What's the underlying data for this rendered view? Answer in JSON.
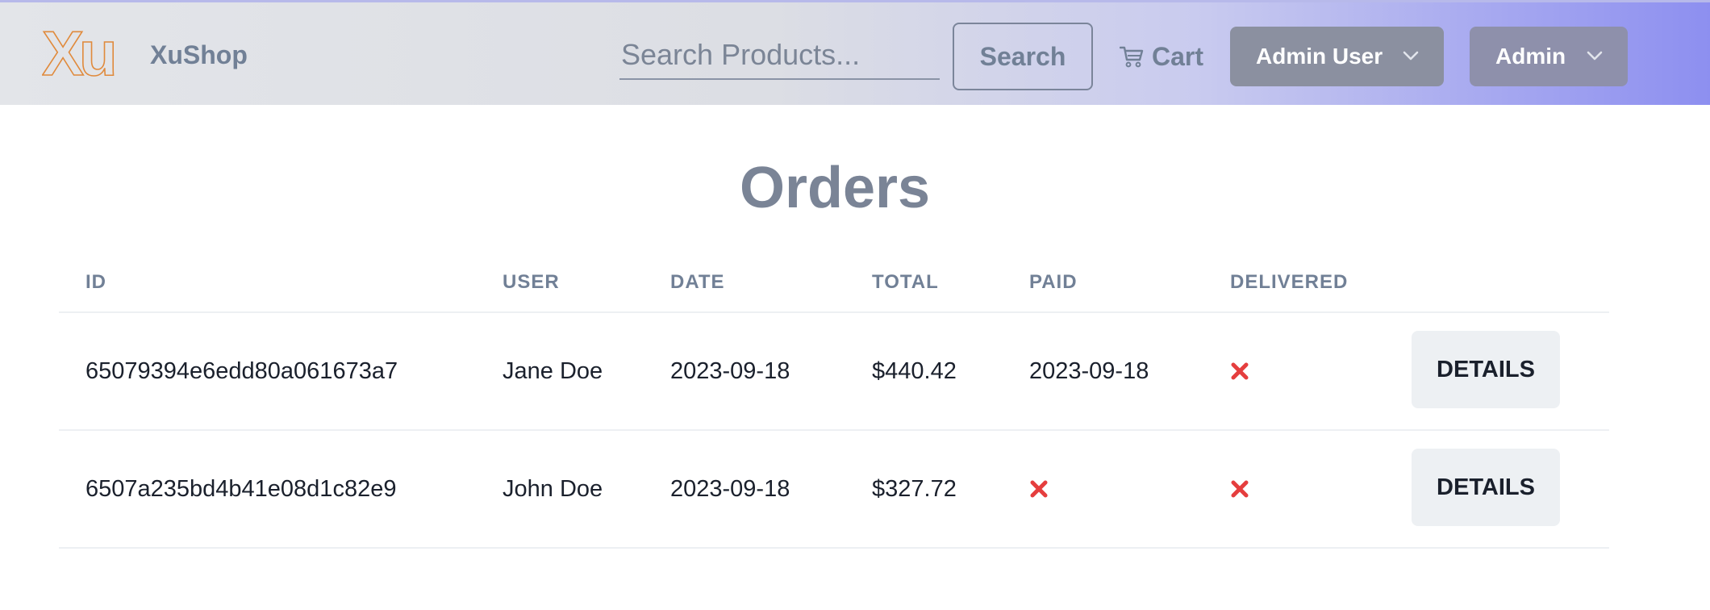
{
  "header": {
    "brand": "XuShop",
    "logo_text": "Xu",
    "search": {
      "placeholder": "Search Products...",
      "value": ""
    },
    "search_button": "Search",
    "cart_label": "Cart",
    "user_menu_label": "Admin User",
    "admin_menu_label": "Admin"
  },
  "page": {
    "title": "Orders"
  },
  "table": {
    "columns": [
      "ID",
      "USER",
      "DATE",
      "TOTAL",
      "PAID",
      "DELIVERED"
    ],
    "rows": [
      {
        "id": "65079394e6edd80a061673a7",
        "user": "Jane Doe",
        "date": "2023-09-18",
        "total": "$440.42",
        "paid": "2023-09-18",
        "paid_status": true,
        "delivered_status": false,
        "action": "DETAILS"
      },
      {
        "id": "6507a235bd4b41e08d1c82e9",
        "user": "John Doe",
        "date": "2023-09-18",
        "total": "$327.72",
        "paid": "",
        "paid_status": false,
        "delivered_status": false,
        "action": "DETAILS"
      }
    ]
  },
  "icons": {
    "not_paid": "x-icon",
    "not_delivered": "x-icon",
    "cart": "cart-icon",
    "dropdown": "chevron-down-icon"
  },
  "colors": {
    "accent": "#8d8ff0",
    "status_no": "#e53e3e",
    "muted_text": "#718096",
    "logo": "#e08a3c"
  }
}
